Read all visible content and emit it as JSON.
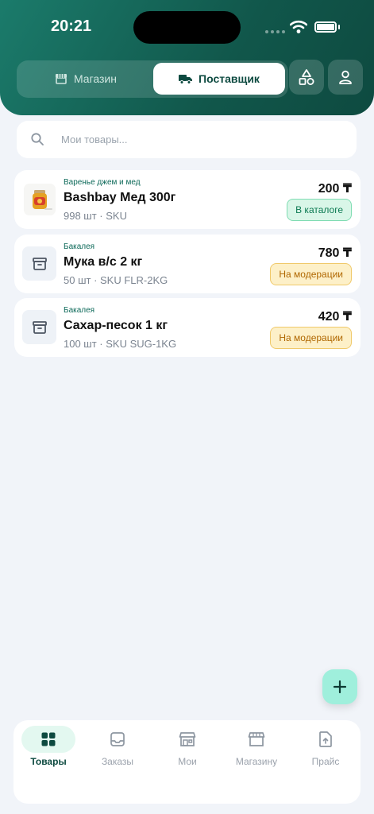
{
  "status_bar": {
    "time": "20:21"
  },
  "header": {
    "segments": [
      {
        "label": "Магазин",
        "icon": "storefront-icon",
        "active": false
      },
      {
        "label": "Поставщик",
        "icon": "truck-icon",
        "active": true
      }
    ],
    "buttons": [
      {
        "icon": "shapes-icon"
      },
      {
        "icon": "user-icon"
      }
    ]
  },
  "search": {
    "placeholder": "Мои товары...",
    "value": ""
  },
  "products": [
    {
      "category": "Варенье джем и мед",
      "name": "Bashbay Мед 300г",
      "meta": "998 шт · SKU",
      "price": "200 ₸",
      "badge": "В каталоге",
      "badge_color": "#0c7a52"
    },
    {
      "category": "Бакалея",
      "name": "Мука в/с 2 кг",
      "meta": "50 шт · SKU FLR-2KG",
      "price": "780 ₸",
      "badge": "На модерации",
      "badge_color": "#b06700"
    },
    {
      "category": "Бакалея",
      "name": "Сахар-песок 1 кг",
      "meta": "100 шт · SKU SUG-1KG",
      "price": "420 ₸",
      "badge": "На модерации",
      "badge_color": "#b06700"
    }
  ],
  "tabbar": {
    "items": [
      {
        "label": "Товары",
        "icon": "grid-icon",
        "active": true
      },
      {
        "label": "Заказы",
        "icon": "inbox-icon",
        "active": false
      },
      {
        "label": "Мои",
        "icon": "store-icon",
        "active": false
      },
      {
        "label": "Магазину",
        "icon": "storefront-icon",
        "active": false
      },
      {
        "label": "Прайс",
        "icon": "file-upload-icon",
        "active": false
      }
    ]
  },
  "colors": {
    "brand": "#11574b",
    "accent": "#9fefdc",
    "background": "#f1f4f9"
  }
}
